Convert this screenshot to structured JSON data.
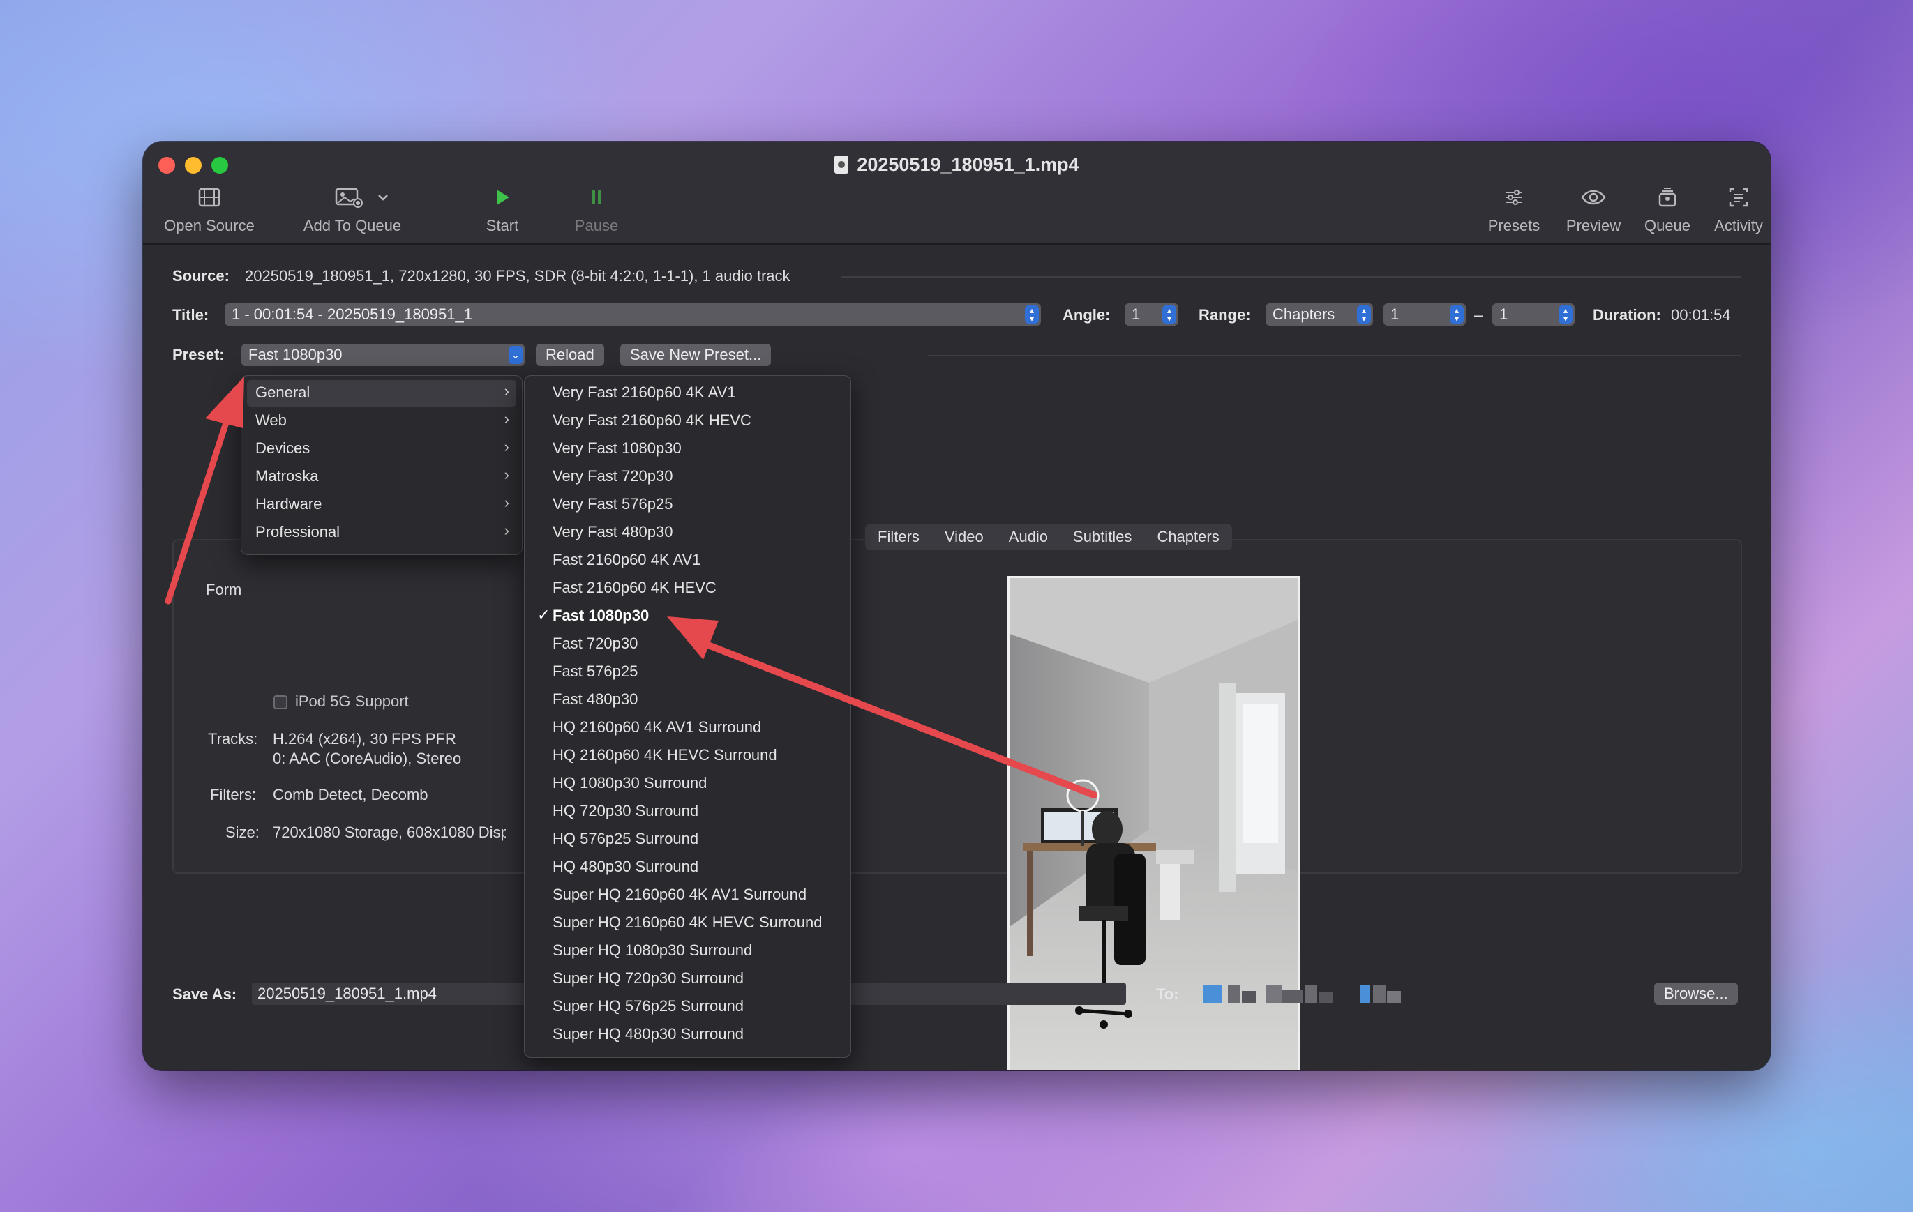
{
  "window": {
    "title": "20250519_180951_1.mp4"
  },
  "toolbar": {
    "open_source": "Open Source",
    "add_to_queue": "Add To Queue",
    "start": "Start",
    "pause": "Pause",
    "presets": "Presets",
    "preview": "Preview",
    "queue": "Queue",
    "activity": "Activity"
  },
  "source": {
    "label": "Source:",
    "value": "20250519_180951_1, 720x1280, 30 FPS, SDR (8-bit 4:2:0, 1-1-1), 1 audio track"
  },
  "title_row": {
    "label": "Title:",
    "value": "1 - 00:01:54 - 20250519_180951_1",
    "angle_label": "Angle:",
    "angle_value": "1",
    "range_label": "Range:",
    "range_value": "Chapters",
    "range_start": "1",
    "range_dash": "–",
    "range_end": "1",
    "duration_label": "Duration:",
    "duration_value": "00:01:54"
  },
  "preset_row": {
    "label": "Preset:",
    "value": "Fast 1080p30",
    "reload": "Reload",
    "save_new": "Save New Preset..."
  },
  "tabs": [
    "Filters",
    "Video",
    "Audio",
    "Subtitles",
    "Chapters"
  ],
  "summary": {
    "format_partial": "Form",
    "ipod_label": "iPod 5G Support",
    "tracks_label": "Tracks:",
    "tracks_line1": "H.264 (x264), 30 FPS PFR",
    "tracks_line2": "0: AAC (CoreAudio), Stereo",
    "filters_label": "Filters:",
    "filters_value": "Comb Detect, Decomb",
    "size_label": "Size:",
    "size_value": "720x1080 Storage, 608x1080 Disp"
  },
  "preset_menu": {
    "categories": [
      {
        "label": "General",
        "highlighted": true
      },
      {
        "label": "Web"
      },
      {
        "label": "Devices"
      },
      {
        "label": "Matroska"
      },
      {
        "label": "Hardware"
      },
      {
        "label": "Professional"
      }
    ],
    "submenu": [
      "Very Fast 2160p60 4K AV1",
      "Very Fast 2160p60 4K HEVC",
      "Very Fast 1080p30",
      "Very Fast 720p30",
      "Very Fast 576p25",
      "Very Fast 480p30",
      "Fast 2160p60 4K AV1",
      "Fast 2160p60 4K HEVC",
      "Fast 1080p30",
      "Fast 720p30",
      "Fast 576p25",
      "Fast 480p30",
      "HQ 2160p60 4K AV1 Surround",
      "HQ 2160p60 4K HEVC Surround",
      "HQ 1080p30 Surround",
      "HQ 720p30 Surround",
      "HQ 576p25 Surround",
      "HQ 480p30 Surround",
      "Super HQ 2160p60 4K AV1 Surround",
      "Super HQ 2160p60 4K HEVC Surround",
      "Super HQ 1080p30 Surround",
      "Super HQ 720p30 Surround",
      "Super HQ 576p25 Surround",
      "Super HQ 480p30 Surround"
    ],
    "checked_item": "Fast 1080p30",
    "check_glyph": "✓",
    "arrow_glyph": "›"
  },
  "save_as": {
    "label": "Save As:",
    "value": "20250519_180951_1.mp4",
    "to_label": "To:",
    "browse": "Browse..."
  },
  "colors": {
    "accent": "#2f6fd6",
    "annotation_arrow": "#e5484d"
  }
}
